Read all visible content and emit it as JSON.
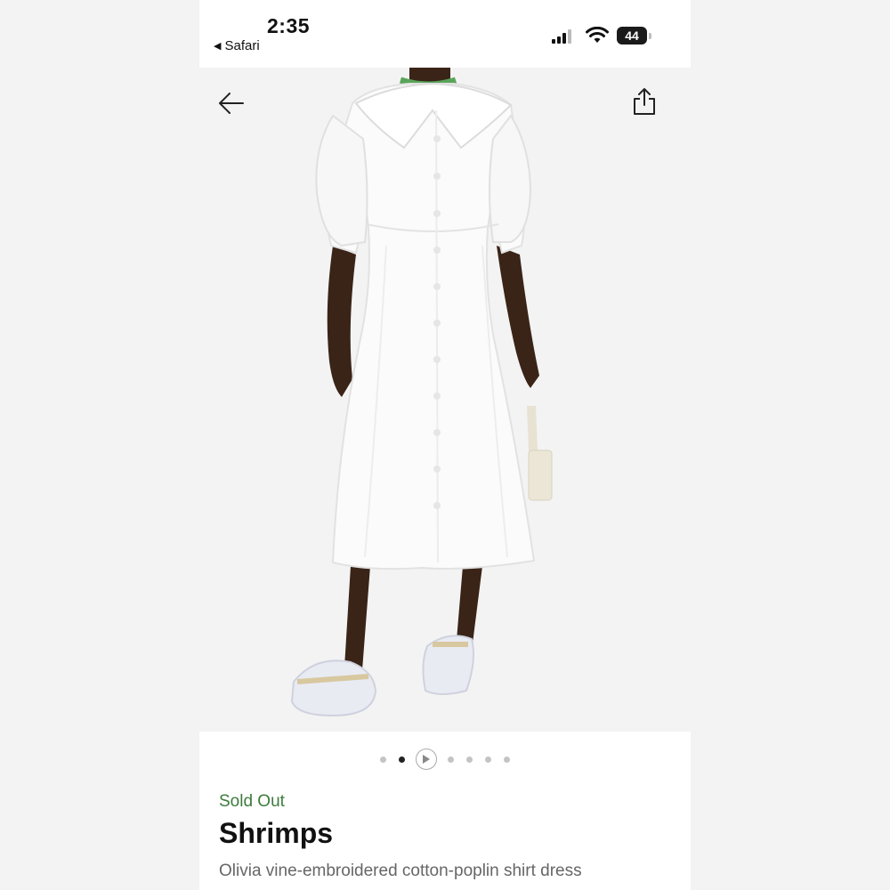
{
  "status_bar": {
    "time": "2:35",
    "back_app": "Safari",
    "battery": "44",
    "icons": [
      "signal-icon",
      "wifi-icon",
      "battery-icon"
    ]
  },
  "product": {
    "availability": "Sold Out",
    "brand": "Shrimps",
    "name": "Olivia vine-embroidered cotton-poplin shirt dress"
  },
  "carousel": {
    "dots": [
      {
        "type": "image",
        "active": false
      },
      {
        "type": "image",
        "active": true
      },
      {
        "type": "video",
        "active": false
      },
      {
        "type": "image",
        "active": false
      },
      {
        "type": "image",
        "active": false
      },
      {
        "type": "image",
        "active": false
      },
      {
        "type": "image",
        "active": false
      }
    ]
  },
  "icons": {
    "back": "arrow-left-icon",
    "share": "share-icon"
  },
  "colors": {
    "availability": "#3d7b3d",
    "brand": "#111111",
    "product_name": "#666666",
    "active_dot": "#222222",
    "inactive_dot": "#c4c4c4"
  }
}
